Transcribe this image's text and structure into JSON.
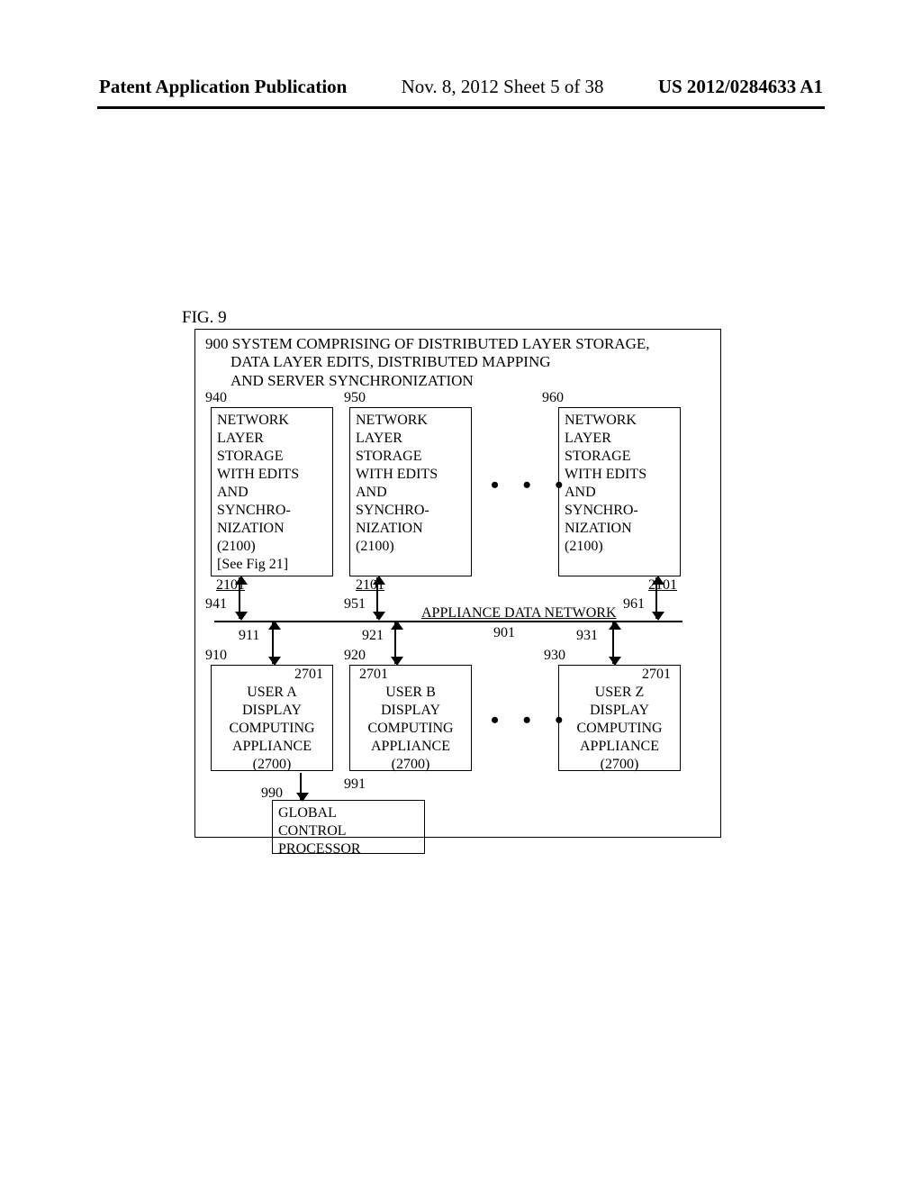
{
  "header": {
    "left": "Patent Application Publication",
    "mid": "Nov. 8, 2012   Sheet 5 of 38",
    "right": "US 2012/0284633 A1"
  },
  "figure_label": "FIG. 9",
  "title": {
    "line1": "900 SYSTEM COMPRISING OF DISTRIBUTED LAYER STORAGE,",
    "line2": "DATA LAYER EDITS, DISTRIBUTED MAPPING",
    "line3": "AND SERVER SYNCHRONIZATION"
  },
  "refs": {
    "r940": "940",
    "r950": "950",
    "r960": "960",
    "r941": "941",
    "r951": "951",
    "r961": "961",
    "r2101a": "2101",
    "r2101b": "2101",
    "r2101c": "2101",
    "r911": "911",
    "r921": "921",
    "r931": "931",
    "r910": "910",
    "r920": "920",
    "r930": "930",
    "r2701a": "2701",
    "r2701b": "2701",
    "r2701c": "2701",
    "r990": "990",
    "r991": "991",
    "r901": "901"
  },
  "network_label": "APPLIANCE DATA NETWORK",
  "storage_box": {
    "l1": "NETWORK",
    "l2": "LAYER",
    "l3": "STORAGE",
    "l4": "WITH EDITS",
    "l5": "AND",
    "l6": "SYNCHRO-",
    "l7": "NIZATION",
    "l8": "(2100)",
    "l9": "[See Fig 21]"
  },
  "user_box": {
    "a": {
      "l1": "USER A",
      "l2": "DISPLAY",
      "l3": "COMPUTING",
      "l4": "APPLIANCE",
      "l5": "(2700)"
    },
    "b": {
      "l1": "USER B",
      "l2": "DISPLAY",
      "l3": "COMPUTING",
      "l4": "APPLIANCE",
      "l5": "(2700)"
    },
    "z": {
      "l1": "USER Z",
      "l2": "DISPLAY",
      "l3": "COMPUTING",
      "l4": "APPLIANCE",
      "l5": "(2700)"
    }
  },
  "global_box": {
    "l1": "GLOBAL",
    "l2": "CONTROL",
    "l3": "PROCESSOR"
  },
  "dots": "•  •  •",
  "chart_data": {
    "type": "diagram",
    "nodes": [
      {
        "id": "940",
        "label": "NETWORK LAYER STORAGE WITH EDITS AND SYNCHRONIZATION (2100)"
      },
      {
        "id": "950",
        "label": "NETWORK LAYER STORAGE WITH EDITS AND SYNCHRONIZATION (2100)"
      },
      {
        "id": "960",
        "label": "NETWORK LAYER STORAGE WITH EDITS AND SYNCHRONIZATION (2100)"
      },
      {
        "id": "910",
        "label": "USER A DISPLAY COMPUTING APPLIANCE (2700)"
      },
      {
        "id": "920",
        "label": "USER B DISPLAY COMPUTING APPLIANCE (2700)"
      },
      {
        "id": "930",
        "label": "USER Z DISPLAY COMPUTING APPLIANCE (2700)"
      },
      {
        "id": "990",
        "label": "GLOBAL CONTROL PROCESSOR"
      },
      {
        "id": "901",
        "label": "APPLIANCE DATA NETWORK"
      }
    ],
    "edges": [
      {
        "from": "940",
        "to": "901",
        "via": "941",
        "port": "2101"
      },
      {
        "from": "950",
        "to": "901",
        "via": "951",
        "port": "2101"
      },
      {
        "from": "960",
        "to": "901",
        "via": "961",
        "port": "2101"
      },
      {
        "from": "910",
        "to": "901",
        "via": "911",
        "port": "2701"
      },
      {
        "from": "920",
        "to": "901",
        "via": "921",
        "port": "2701"
      },
      {
        "from": "930",
        "to": "901",
        "via": "931",
        "port": "2701"
      },
      {
        "from": "990",
        "to": "910",
        "via": "991"
      }
    ],
    "title": "900 SYSTEM COMPRISING OF DISTRIBUTED LAYER STORAGE, DATA LAYER EDITS, DISTRIBUTED MAPPING AND SERVER SYNCHRONIZATION"
  }
}
